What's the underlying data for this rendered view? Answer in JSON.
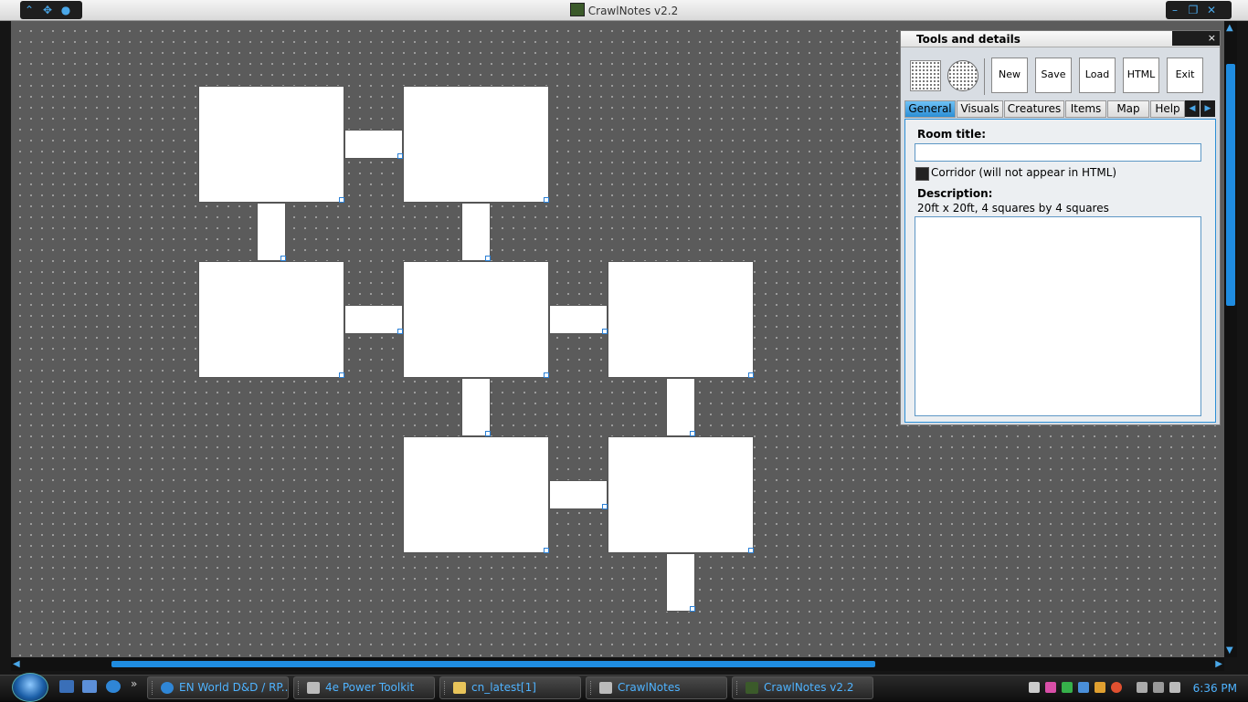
{
  "window": {
    "title": "CrawlNotes v2.2",
    "app_icon": "crawlnotes-app-icon",
    "left_controls": [
      "chevron-up-icon",
      "dropbox-icon",
      "alienware-head-icon"
    ],
    "right_controls": [
      "minimize-icon",
      "restore-icon",
      "close-icon"
    ]
  },
  "panel": {
    "title": "Tools and details",
    "close_label": "×",
    "tools": [
      {
        "name": "square-room-tool",
        "icon": "dotted-square-icon"
      },
      {
        "name": "circle-room-tool",
        "icon": "dotted-circle-icon"
      }
    ],
    "buttons": {
      "new": "New",
      "save": "Save",
      "load": "Load",
      "html": "HTML",
      "exit": "Exit"
    },
    "tabs": [
      "General",
      "Visuals",
      "Creatures",
      "Items",
      "Map",
      "Help"
    ],
    "active_tab": "General",
    "general": {
      "room_title_label": "Room title:",
      "room_title_value": "",
      "corridor_label": "Corridor (will not appear in HTML)",
      "corridor_checked": true,
      "description_label": "Description:",
      "description_info": "20ft x 20ft, 4 squares by 4 squares",
      "description_value": ""
    }
  },
  "taskbar": {
    "tasks": [
      {
        "label": "EN World D&D / RP...",
        "icon": "internet-explorer-icon"
      },
      {
        "label": "4e Power Toolkit",
        "icon": "application-icon"
      },
      {
        "label": "cn_latest[1]",
        "icon": "folder-zip-icon"
      },
      {
        "label": "CrawlNotes",
        "icon": "application-icon"
      },
      {
        "label": "CrawlNotes v2.2",
        "icon": "crawlnotes-app-icon"
      }
    ],
    "quick_launch": [
      "show-desktop-icon",
      "switch-windows-icon",
      "internet-explorer-icon"
    ],
    "overflow": "»",
    "clock": "6:36 PM"
  },
  "colors": {
    "accent": "#1f8ce0",
    "canvas": "#5b5b5b",
    "room_fill": "#ffffff",
    "taskbar_text": "#4fb3ff"
  }
}
